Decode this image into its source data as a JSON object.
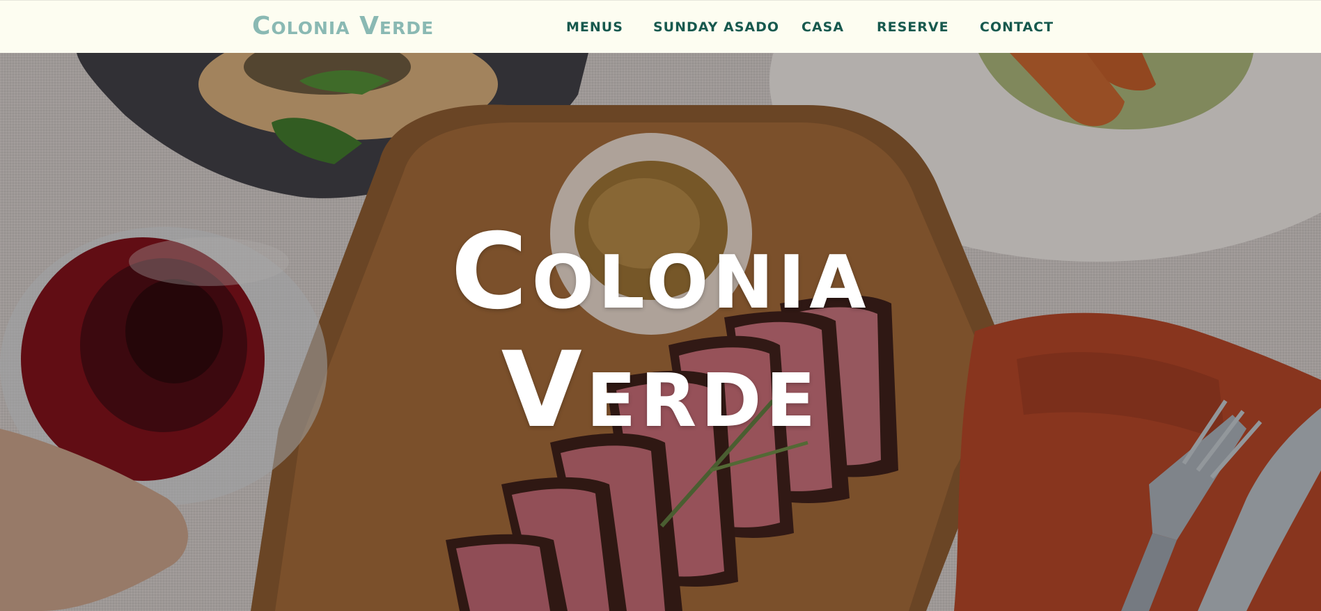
{
  "header": {
    "logo": "Colonia Verde",
    "nav": [
      {
        "label": "MENUS"
      },
      {
        "label": "SUNDAY ASADO"
      },
      {
        "label": "CASA"
      },
      {
        "label": "RESERVE"
      },
      {
        "label": "CONTACT"
      }
    ]
  },
  "hero": {
    "title_line1": "Colonia",
    "title_line2": "Verde",
    "image": "hero-food-photo"
  },
  "colors": {
    "header_bg": "#fdfdf1",
    "logo": "#8ab9b3",
    "nav_text": "#17594e",
    "hero_text": "#ffffff"
  }
}
